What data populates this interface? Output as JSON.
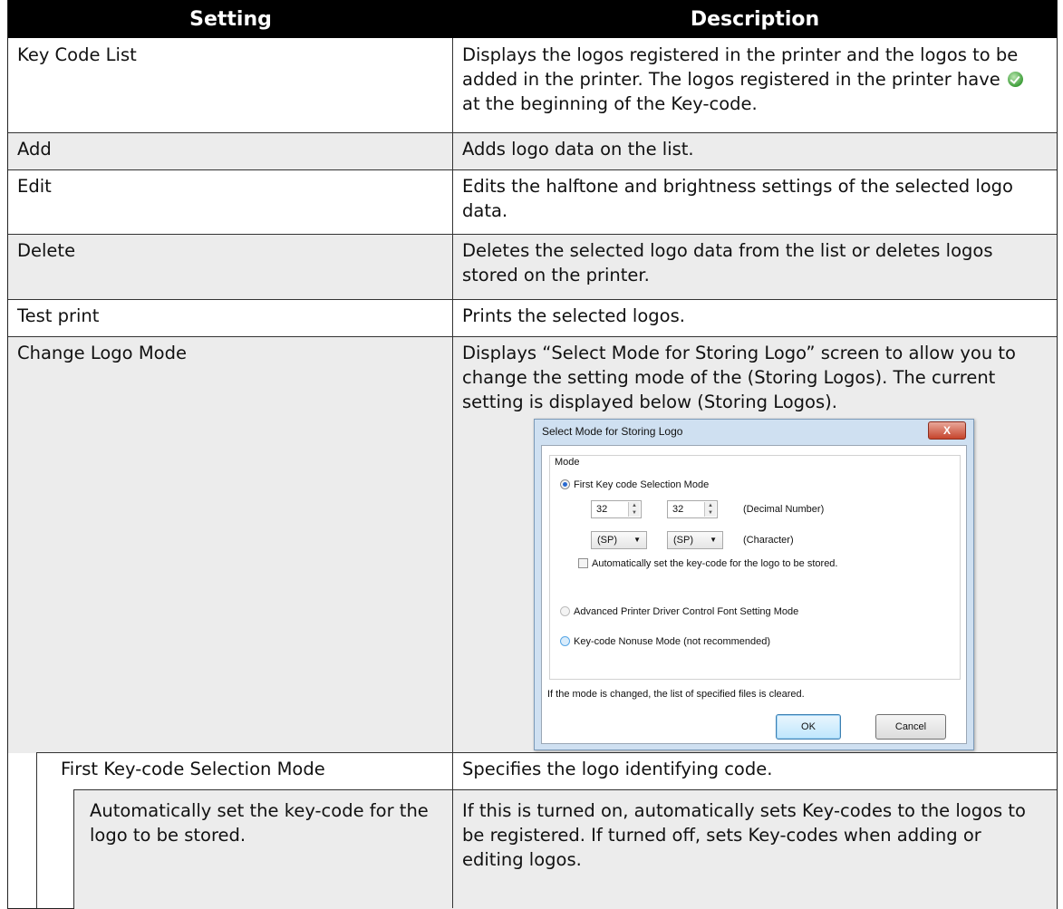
{
  "header": {
    "setting": "Setting",
    "description": "Description"
  },
  "rows": [
    {
      "setting": "Key Code List",
      "desc_before_icon": "Displays the logos registered in the printer and the logos to be added in the printer. The logos registered in the printer have",
      "desc_after_icon": "at the beginning of the Key-code."
    },
    {
      "setting": "Add",
      "description": "Adds logo data on the list."
    },
    {
      "setting": "Edit",
      "description": "Edits the halftone and brightness settings of the selected logo data."
    },
    {
      "setting": "Delete",
      "description": "Deletes the selected logo data from the list or deletes logos stored on the printer."
    },
    {
      "setting": "Test print",
      "description": "Prints the selected logos."
    },
    {
      "setting": "Change Logo Mode",
      "description": "Displays “Select Mode for Storing Logo” screen to allow you to change the setting mode of the (Storing Logos). The current setting is displayed below (Storing Logos)."
    },
    {
      "setting": "First Key-code Selection Mode",
      "description": "Specifies the logo identifying code."
    },
    {
      "setting": "Automatically set the key-code for the logo to be stored.",
      "description": "If this is turned on, automatically sets Key-codes to the logos to be registered. If turned off, sets Key-codes when adding or editing logos."
    }
  ],
  "dialog": {
    "title": "Select Mode for Storing Logo",
    "close_label": "X",
    "group_label": "Mode",
    "first_mode_label": "First Key code Selection Mode",
    "decimal_1": "32",
    "decimal_2": "32",
    "decimal_caption": "(Decimal Number)",
    "char_1": "(SP)",
    "char_2": "(SP)",
    "char_caption": "(Character)",
    "auto_set_label": "Automatically set the key-code for the logo to be stored.",
    "advanced_label": "Advanced Printer Driver Control Font Setting Mode",
    "nonuse_label": "Key-code Nonuse Mode (not recommended)",
    "note": "If the mode is changed, the list of specified files is cleared.",
    "ok_label": "OK",
    "cancel_label": "Cancel"
  }
}
